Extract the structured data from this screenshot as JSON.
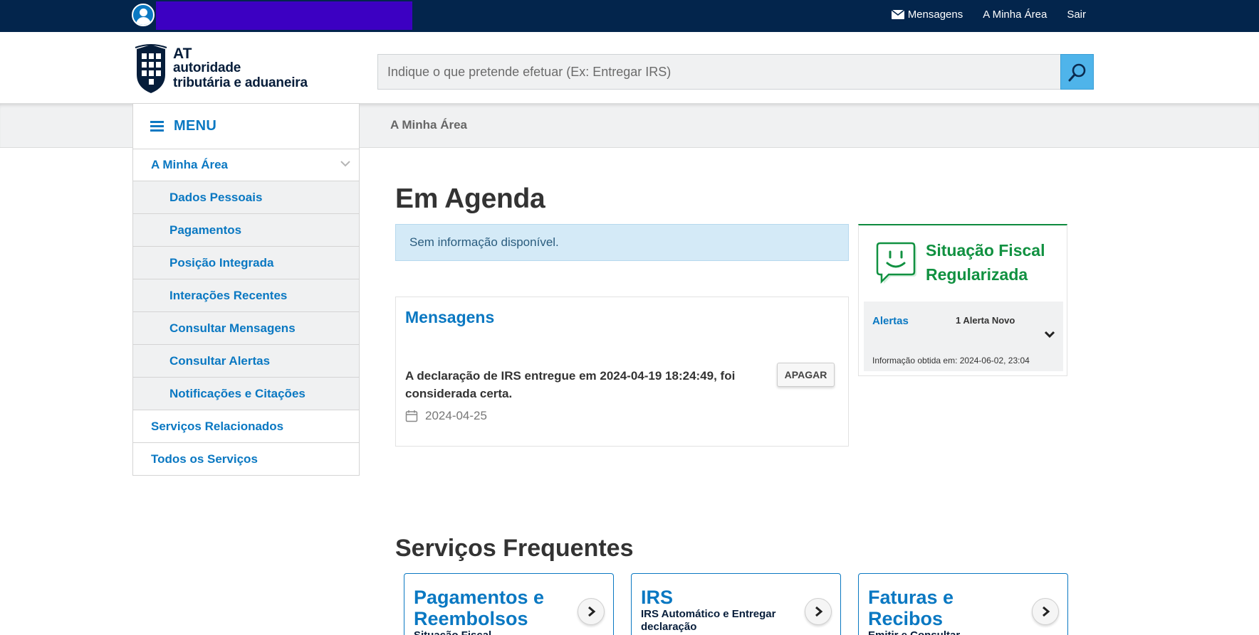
{
  "topbar": {
    "links": {
      "messages": "Mensagens",
      "my_area": "A Minha Área",
      "logout": "Sair"
    }
  },
  "logo": {
    "at": "AT",
    "line1": "autoridade",
    "line2": "tributária e aduaneira"
  },
  "search": {
    "placeholder": "Indique o que pretende efetuar (Ex: Entregar IRS)"
  },
  "breadcrumb": "A Minha Área",
  "menu": {
    "title": "MENU",
    "items": [
      "A Minha Área",
      "Dados Pessoais",
      "Pagamentos",
      "Posição Integrada",
      "Interações Recentes",
      "Consultar Mensagens",
      "Consultar Alertas",
      "Notificações e Citações",
      "Serviços Relacionados",
      "Todos os Serviços"
    ]
  },
  "agenda": {
    "title": "Em Agenda",
    "info": "Sem informação disponível."
  },
  "messages_card": {
    "title": "Mensagens",
    "text": "A declaração de IRS entregue em 2024-04-19 18:24:49, foi considerada certa.",
    "date": "2024-04-25",
    "delete_label": "APAGAR"
  },
  "fiscal": {
    "title_line1": "Situação Fiscal",
    "title_line2": "Regularizada",
    "alerts_label": "Alertas",
    "alerts_count": "1 Alerta Novo",
    "info": "Informação obtida em: 2024-06-02, 23:04"
  },
  "frequent": {
    "title": "Serviços Frequentes",
    "cards": [
      {
        "title": "Pagamentos e Reembolsos",
        "subtitle": "Situação Fiscal"
      },
      {
        "title": "IRS",
        "subtitle": "IRS Automático e Entregar declaração"
      },
      {
        "title": "Faturas e Recibos",
        "subtitle": "Emitir e Consultar"
      }
    ]
  },
  "colors": {
    "topbar": "#03254c",
    "accent": "#0a78c2",
    "success": "#119141",
    "info_bg": "#d4eaf7"
  }
}
